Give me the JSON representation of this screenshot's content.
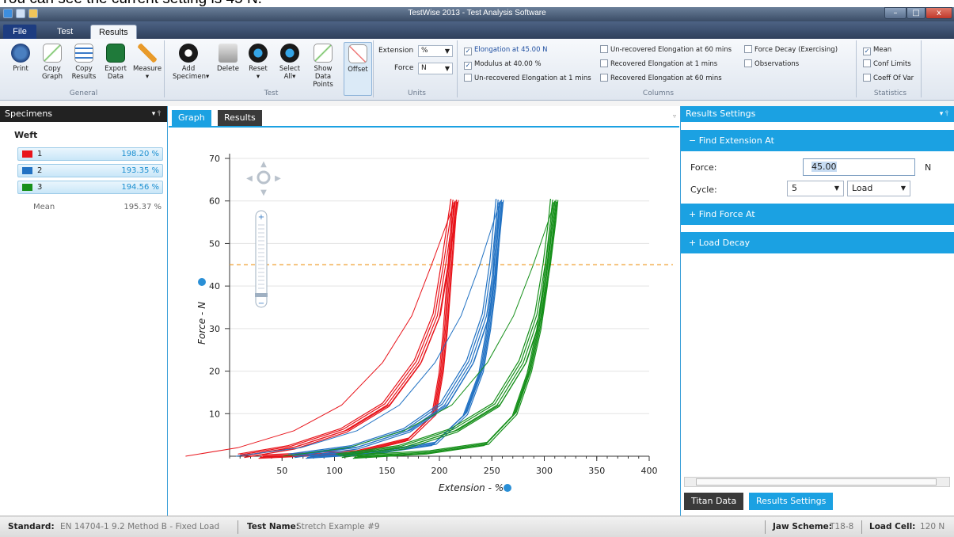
{
  "caption": "You can see the current setting is 45 N.",
  "window": {
    "title": "TestWise 2013 - Test Analysis Software",
    "minimize": "–",
    "maximize": "□",
    "close": "x"
  },
  "ribbon_tabs": [
    "File",
    "Test",
    "Results"
  ],
  "general": {
    "label": "General",
    "buttons": [
      {
        "label": "Print",
        "icon": "printer-icon"
      },
      {
        "label": "Copy Graph",
        "icon": "copy-graph-icon"
      },
      {
        "label": "Copy Results",
        "icon": "copy-results-icon"
      },
      {
        "label": "Export Data",
        "icon": "excel-export-icon"
      },
      {
        "label": "Measure",
        "icon": "pencil-icon",
        "arrow": "▾"
      }
    ]
  },
  "test": {
    "label": "Test",
    "buttons": [
      {
        "label": "Add Specimen",
        "icon": "add-specimen-icon",
        "arrow": "▾"
      },
      {
        "label": "Delete",
        "icon": "recycle-bin-icon"
      },
      {
        "label": "Reset",
        "icon": "reset-icon",
        "arrow": "▾"
      },
      {
        "label": "Select All",
        "icon": "select-all-icon",
        "arrow": "▾"
      },
      {
        "label": "Show Data Points",
        "icon": "data-points-icon"
      },
      {
        "label": "Offset",
        "icon": "offset-icon"
      }
    ]
  },
  "units": {
    "label": "Units",
    "extension_label": "Extension",
    "extension_value": "%",
    "force_label": "Force",
    "force_value": "N"
  },
  "columns": {
    "label": "Columns",
    "items": [
      {
        "text": "Elongation at 45.00 N",
        "checked": true
      },
      {
        "text": "Modulus at 40.00 %",
        "checked": true
      },
      {
        "text": "Un-recovered Elongation at 1 mins",
        "checked": false
      },
      {
        "text": "Un-recovered Elongation at 60 mins",
        "checked": false
      },
      {
        "text": "Recovered Elongation at 1 mins",
        "checked": false
      },
      {
        "text": "Recovered Elongation at 60 mins",
        "checked": false
      },
      {
        "text": "Force Decay (Exercising)",
        "checked": false
      },
      {
        "text": "Observations",
        "checked": false
      }
    ]
  },
  "statistics": {
    "label": "Statistics",
    "items": [
      {
        "text": "Mean",
        "checked": true
      },
      {
        "text": "Conf Limits",
        "checked": false
      },
      {
        "text": "Coeff Of Var",
        "checked": false
      }
    ]
  },
  "specimens": {
    "header": "Specimens",
    "pin": "▾ ⫯",
    "group": "Weft",
    "rows": [
      {
        "name": "1",
        "value": "198.20 %",
        "color": "#e8141b"
      },
      {
        "name": "2",
        "value": "193.35 %",
        "color": "#2272c3"
      },
      {
        "name": "3",
        "value": "194.56 %",
        "color": "#17901b"
      }
    ],
    "mean_label": "Mean",
    "mean_value": "195.37 %"
  },
  "graph_tabs": [
    "Graph",
    "Results"
  ],
  "chart_data": {
    "type": "line",
    "xlabel": "Extension - %",
    "ylabel": "Force - N",
    "xlim": [
      0,
      400
    ],
    "ylim": [
      0,
      70
    ],
    "xticks": [
      50,
      100,
      150,
      200,
      250,
      300,
      350,
      400
    ],
    "yticks": [
      10,
      20,
      30,
      40,
      50,
      60,
      70
    ],
    "reference_line": {
      "y": 45,
      "color": "#f0a030",
      "style": "dashed"
    },
    "grid": true,
    "series": [
      {
        "color": "#e8141b",
        "loading": [
          [
            12,
            0
          ],
          [
            60,
            2
          ],
          [
            110,
            6
          ],
          [
            150,
            12
          ],
          [
            180,
            22
          ],
          [
            198,
            33
          ],
          [
            206,
            45
          ],
          [
            212,
            55
          ],
          [
            215,
            60
          ]
        ],
        "unloading": [
          [
            215,
            60
          ],
          [
            212,
            50
          ],
          [
            209,
            40
          ],
          [
            206,
            30
          ],
          [
            202,
            20
          ],
          [
            195,
            10
          ],
          [
            170,
            4
          ],
          [
            120,
            1
          ],
          [
            30,
            0
          ]
        ]
      },
      {
        "color": "#2272c3",
        "loading": [
          [
            60,
            0
          ],
          [
            120,
            2
          ],
          [
            170,
            6
          ],
          [
            205,
            12
          ],
          [
            230,
            22
          ],
          [
            245,
            33
          ],
          [
            252,
            45
          ],
          [
            256,
            55
          ],
          [
            258,
            60
          ]
        ],
        "unloading": [
          [
            258,
            60
          ],
          [
            255,
            50
          ],
          [
            252,
            40
          ],
          [
            247,
            30
          ],
          [
            240,
            20
          ],
          [
            225,
            10
          ],
          [
            195,
            3
          ],
          [
            140,
            1
          ],
          [
            75,
            0
          ]
        ]
      },
      {
        "color": "#17901b",
        "loading": [
          [
            105,
            0
          ],
          [
            165,
            2
          ],
          [
            215,
            6
          ],
          [
            255,
            12
          ],
          [
            280,
            22
          ],
          [
            295,
            33
          ],
          [
            303,
            45
          ],
          [
            308,
            55
          ],
          [
            310,
            60
          ]
        ],
        "unloading": [
          [
            310,
            60
          ],
          [
            306,
            50
          ],
          [
            301,
            40
          ],
          [
            295,
            30
          ],
          [
            286,
            20
          ],
          [
            272,
            10
          ],
          [
            245,
            3
          ],
          [
            190,
            1
          ],
          [
            120,
            0
          ]
        ]
      }
    ]
  },
  "nav_arrows": {
    "up": "▲",
    "down": "▼",
    "left": "◀",
    "right": "▶"
  },
  "zoom": {
    "plus": "+",
    "minus": "−"
  },
  "results_settings": {
    "header": "Results Settings",
    "pin": "▾ ⫯",
    "find_extension": "− Find Extension At",
    "force_label": "Force:",
    "force_value": "45.00",
    "force_unit": "N",
    "cycle_label": "Cycle:",
    "cycle_value": "5",
    "cycle_mode": "Load",
    "find_force": "+ Find Force At",
    "load_decay": "+ Load Decay",
    "bottom_tabs": [
      "Titan Data",
      "Results Settings"
    ]
  },
  "status": {
    "standard_label": "Standard:",
    "standard_value": "EN 14704-1 9.2 Method B - Fixed Load",
    "testname_label": "Test Name:",
    "testname_value": "Stretch Example #9",
    "jaw_label": "Jaw Scheme:",
    "jaw_value": "T18-8",
    "loadcell_label": "Load Cell:",
    "loadcell_value": "120 N"
  }
}
